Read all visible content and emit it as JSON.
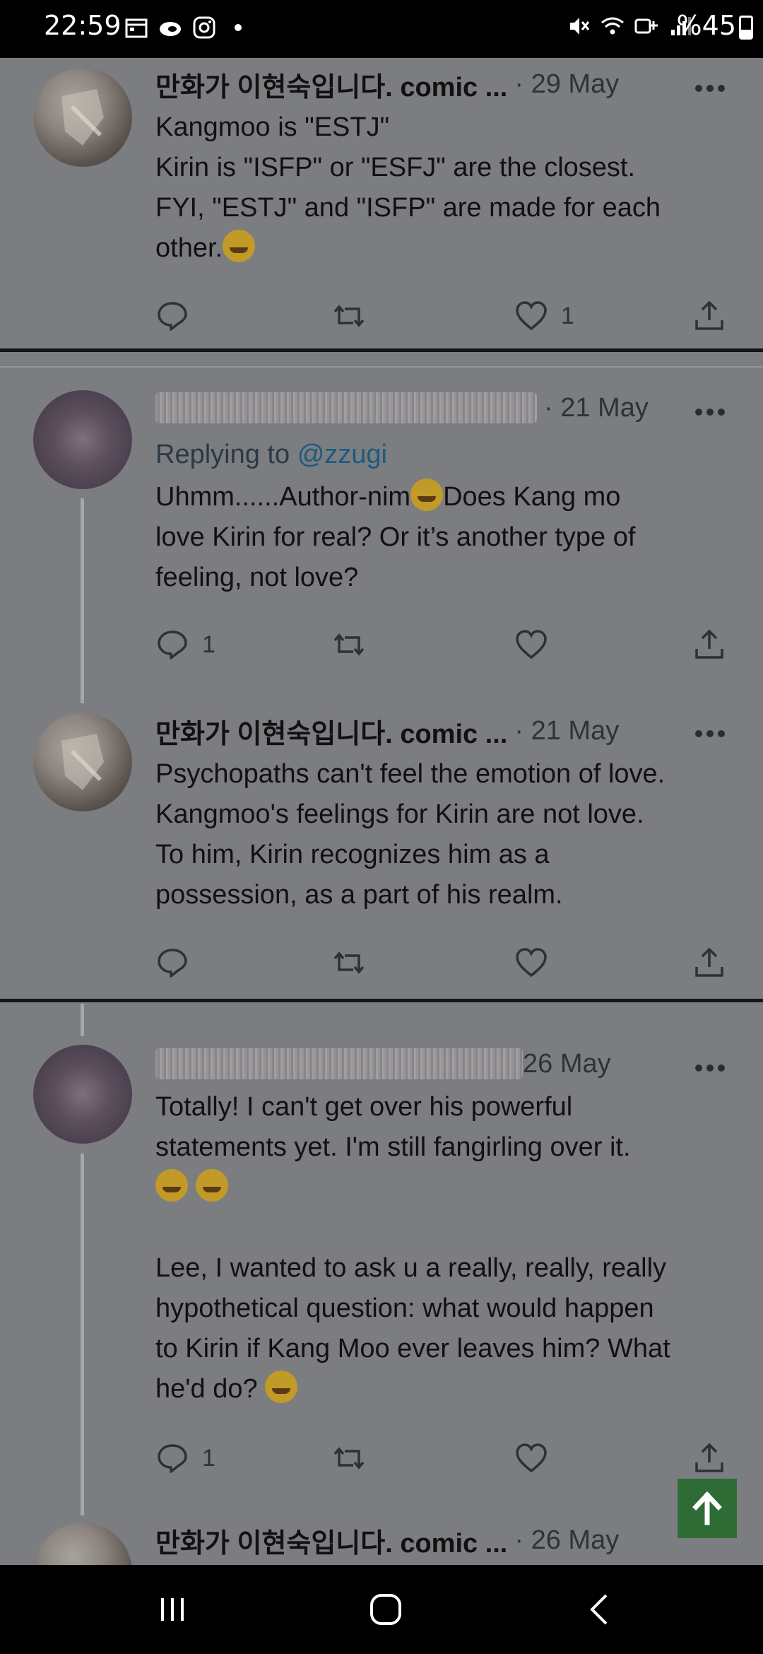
{
  "status_bar": {
    "time": "22:59",
    "battery": "%45",
    "left_icons": [
      "calendar-icon",
      "cloud-icon",
      "instagram-icon",
      "dot-icon"
    ],
    "right_icons": [
      "mute-icon",
      "wifi-icon",
      "volte-icon",
      "signal-icon",
      "battery-icon"
    ]
  },
  "tweets": [
    {
      "author": "만화가 이현숙입니다. comic ...",
      "date": "· 29 May",
      "lines": [
        "Kangmoo is \"ESTJ\"",
        "Kirin is \"ISFP\" or \"ESFJ\" are the closest.",
        "FYI, \"ESTJ\" and \"ISFP\" are made for each",
        "other."
      ],
      "emoji": "grinning-emoji",
      "reply_count": "",
      "like_count": "1"
    },
    {
      "author": "",
      "date": "· 21 May",
      "replying_prefix": "Replying to",
      "replying_handle": "@zzugi",
      "line1_a": "Uhmm......Author-nim",
      "line1_b": "Does Kang mo",
      "lines": [
        "love Kirin for real? Or it’s another type of",
        "feeling, not love?"
      ],
      "emoji": "eye-roll-emoji",
      "reply_count": "1",
      "like_count": ""
    },
    {
      "author": "만화가 이현숙입니다. comic ...",
      "date": "· 21 May",
      "lines": [
        "Psychopaths can't feel the emotion of love.",
        "Kangmoo's feelings for Kirin are not love.",
        "To him, Kirin recognizes him as a",
        "possession, as a part of his realm."
      ],
      "reply_count": "",
      "like_count": ""
    },
    {
      "author": "",
      "date": "26 May",
      "lines": [
        "Totally! I can't get over his powerful",
        "statements yet. I'm still fangirling over it."
      ],
      "emoji": "laughing-emoji",
      "lines2": [
        "Lee, I wanted to ask u a really, really, really",
        "hypothetical question: what would happen",
        "to Kirin if Kang Moo ever leaves him? What",
        "he'd do?"
      ],
      "emoji2": "thinking-emoji",
      "reply_count": "1",
      "like_count": ""
    },
    {
      "author": "만화가 이현숙입니다. comic ...",
      "date": "· 26 May"
    }
  ],
  "nav": [
    "recent-apps-icon",
    "home-icon",
    "back-icon"
  ],
  "colors": {
    "background": "#7c7d81",
    "scroll_button": "#2f6b34",
    "handle": "#1c5a7e"
  }
}
